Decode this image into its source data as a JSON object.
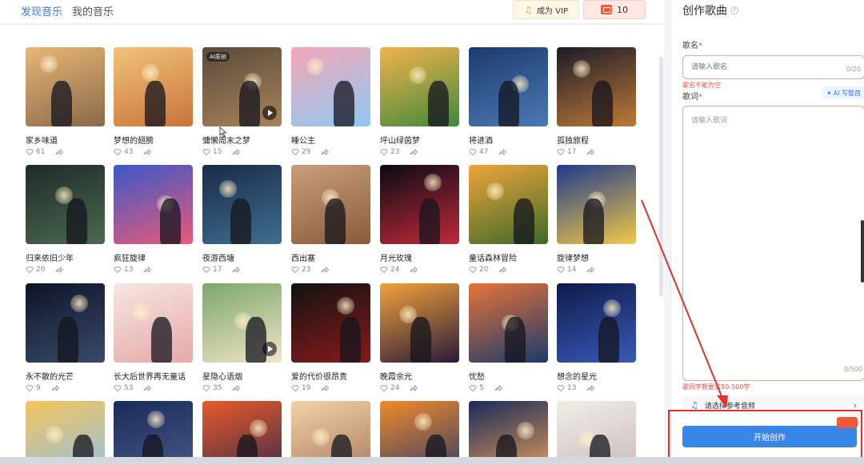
{
  "header": {
    "tab_discover": "发现音乐",
    "tab_mine": "我的音乐",
    "vip_label": "成为 VIP",
    "coins": "10"
  },
  "songs": [
    {
      "title": "家乡味道",
      "likes": "61",
      "colors": [
        "#e8b576",
        "#8a6a4a"
      ]
    },
    {
      "title": "梦想的翅膀",
      "likes": "43",
      "colors": [
        "#f2c27c",
        "#c8743a"
      ]
    },
    {
      "title": "慵懒周末之梦",
      "likes": "15",
      "colors": [
        "#5b4a3c",
        "#a88358"
      ],
      "badge": "AI原创",
      "play": true
    },
    {
      "title": "睡公主",
      "likes": "29",
      "colors": [
        "#f5a6b8",
        "#8ec9f0"
      ]
    },
    {
      "title": "坪山绿茵梦",
      "likes": "23",
      "colors": [
        "#f4b24c",
        "#3f8a3a"
      ]
    },
    {
      "title": "将进酒",
      "likes": "47",
      "colors": [
        "#1d3a6e",
        "#4b79b5"
      ]
    },
    {
      "title": "孤独旅程",
      "likes": "17",
      "colors": [
        "#1a1a2a",
        "#c07a35"
      ]
    },
    {
      "title": "归来依旧少年",
      "likes": "20",
      "colors": [
        "#1f2a2a",
        "#4a6a4e"
      ]
    },
    {
      "title": "疯狂旋律",
      "likes": "13",
      "colors": [
        "#3a59c8",
        "#e85a7a"
      ]
    },
    {
      "title": "夜游西塘",
      "likes": "17",
      "colors": [
        "#1a2a4a",
        "#3f6f8f"
      ]
    },
    {
      "title": "西出塞",
      "likes": "23",
      "colors": [
        "#c8a07a",
        "#8a5a3a"
      ]
    },
    {
      "title": "月光玫瑰",
      "likes": "24",
      "colors": [
        "#0a0a14",
        "#c22a3a"
      ]
    },
    {
      "title": "童话森林冒险",
      "likes": "20",
      "colors": [
        "#f0a43c",
        "#3d6a2a"
      ]
    },
    {
      "title": "旋律梦想",
      "likes": "14",
      "colors": [
        "#1e3a8a",
        "#f2c84a"
      ]
    },
    {
      "title": "永不散的光芒",
      "likes": "9",
      "colors": [
        "#0e1428",
        "#3a4a6a"
      ]
    },
    {
      "title": "长大后世界再无童话",
      "likes": "53",
      "colors": [
        "#f6e6e2",
        "#e6a8a8"
      ]
    },
    {
      "title": "星隐心语烟",
      "likes": "35",
      "colors": [
        "#7aa86a",
        "#f2e2c8"
      ],
      "play": true
    },
    {
      "title": "爱的代价很昂贵",
      "likes": "19",
      "colors": [
        "#121212",
        "#8a1a1a"
      ]
    },
    {
      "title": "晚霞余光",
      "likes": "24",
      "colors": [
        "#f2a23a",
        "#2a1a3a"
      ]
    },
    {
      "title": "忧愁",
      "likes": "5",
      "colors": [
        "#e8733a",
        "#1a3a6a"
      ]
    },
    {
      "title": "想念的星光",
      "likes": "13",
      "colors": [
        "#0e1a4a",
        "#3a5ab8"
      ]
    },
    {
      "title": "",
      "likes": "",
      "colors": [
        "#f6c45a",
        "#8ec0e8"
      ]
    },
    {
      "title": "",
      "likes": "",
      "colors": [
        "#1a2a5a",
        "#4a5a8a"
      ]
    },
    {
      "title": "",
      "likes": "",
      "colors": [
        "#e85a2a",
        "#3a2a4a"
      ]
    },
    {
      "title": "",
      "likes": "",
      "colors": [
        "#f2d2a8",
        "#a87a5a"
      ]
    },
    {
      "title": "",
      "likes": "",
      "colors": [
        "#f28a2a",
        "#2a3a6a"
      ]
    },
    {
      "title": "",
      "likes": "",
      "colors": [
        "#1a2a5a",
        "#e8a25a"
      ]
    },
    {
      "title": "",
      "likes": "",
      "colors": [
        "#f0eee8",
        "#c8b8b8"
      ]
    }
  ],
  "panel": {
    "title": "创作歌曲",
    "name_label": "歌名",
    "name_placeholder": "请输入歌名",
    "name_count": "0/20",
    "name_error": "歌名不能为空",
    "lyrics_label": "歌词",
    "ai_button": "AI 写整首",
    "lyrics_placeholder": "请输入歌词",
    "lyrics_count": "0/500",
    "lyrics_error": "歌词字数要求50-500字",
    "ref_audio": "请选择参考音频",
    "create_button": "开始创作"
  },
  "colors": {
    "accent": "#3a86e6",
    "error": "#e0524c",
    "annotation": "#e3312d"
  }
}
